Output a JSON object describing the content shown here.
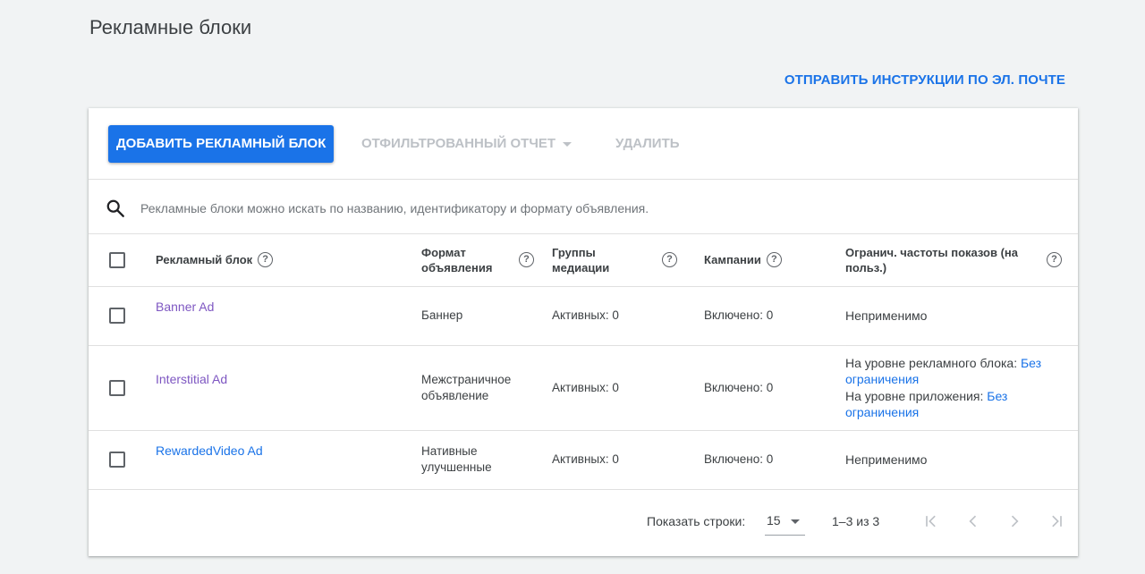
{
  "page": {
    "title": "Рекламные блоки",
    "email_link": "ОТПРАВИТЬ ИНСТРУКЦИИ ПО ЭЛ. ПОЧТЕ"
  },
  "toolbar": {
    "add_label": "ДОБАВИТЬ РЕКЛАМНЫЙ БЛОК",
    "filter_label": "ОТФИЛЬТРОВАННЫЙ ОТЧЕТ",
    "delete_label": "УДАЛИТЬ"
  },
  "search": {
    "placeholder": "Рекламные блоки можно искать по названию, идентификатору и формату объявления."
  },
  "table": {
    "headers": {
      "name": "Рекламный блок",
      "format": "Формат объявления",
      "groups": "Группы медиации",
      "campaigns": "Кампании",
      "freq": "Огранич. частоты показов (на польз.)"
    },
    "rows": [
      {
        "name": "Banner Ad",
        "format": "Баннер",
        "groups": "Активных: 0",
        "campaigns": "Включено: 0",
        "freq": "Неприменимо"
      },
      {
        "name": "Interstitial Ad",
        "format": "Межстраничное объявление",
        "groups": "Активных: 0",
        "campaigns": "Включено: 0",
        "freq_block_label": "На уровне рекламного блока:",
        "freq_block_value": "Без ограничения",
        "freq_app_label": "На уровне приложения:",
        "freq_app_value": "Без ограничения"
      },
      {
        "name": "RewardedVideo Ad",
        "format": "Нативные улучшенные",
        "groups": "Активных: 0",
        "campaigns": "Включено: 0",
        "freq": "Неприменимо"
      }
    ]
  },
  "footer": {
    "rows_label": "Показать строки:",
    "rows_value": "15",
    "range": "1–3 из 3"
  },
  "colors": {
    "accent": "#1a73e8",
    "visited_link": "#7e57c2",
    "disabled": "#bdc1c6",
    "background": "#f1f3f4"
  },
  "icons": {
    "search": "search-icon",
    "help": "help-icon",
    "first_page": "first-page-icon",
    "prev_page": "chevron-left-icon",
    "next_page": "chevron-right-icon",
    "last_page": "last-page-icon"
  }
}
